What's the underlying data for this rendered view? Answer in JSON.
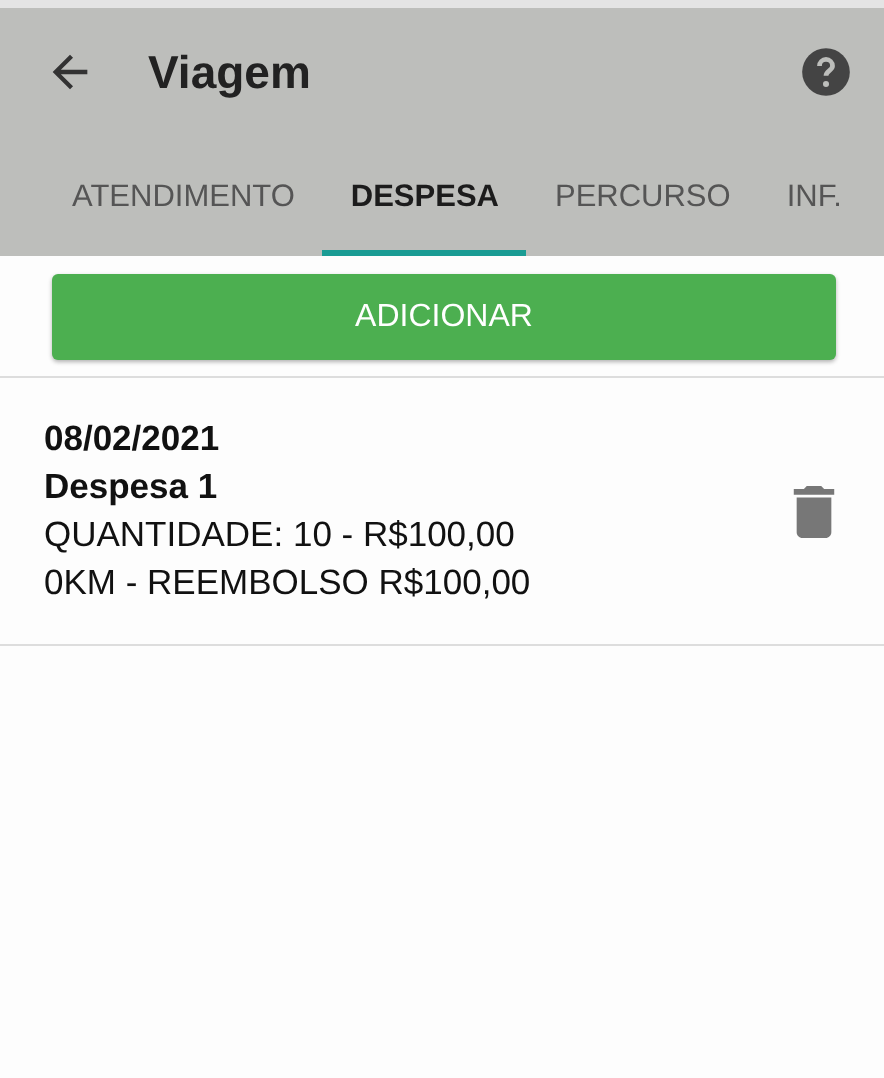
{
  "toolbar": {
    "title": "Viagem"
  },
  "tabs": [
    {
      "label": "ATENDIMENTO",
      "selected": false
    },
    {
      "label": "DESPESA",
      "selected": true
    },
    {
      "label": "PERCURSO",
      "selected": false
    },
    {
      "label": "INF.",
      "selected": false
    }
  ],
  "add_button": "ADICIONAR",
  "expenses": [
    {
      "date": "08/02/2021",
      "title": "Despesa 1",
      "quantity": "QUANTIDADE: 10 - R$100,00",
      "refund": "0KM - REEMBOLSO R$100,00"
    }
  ]
}
